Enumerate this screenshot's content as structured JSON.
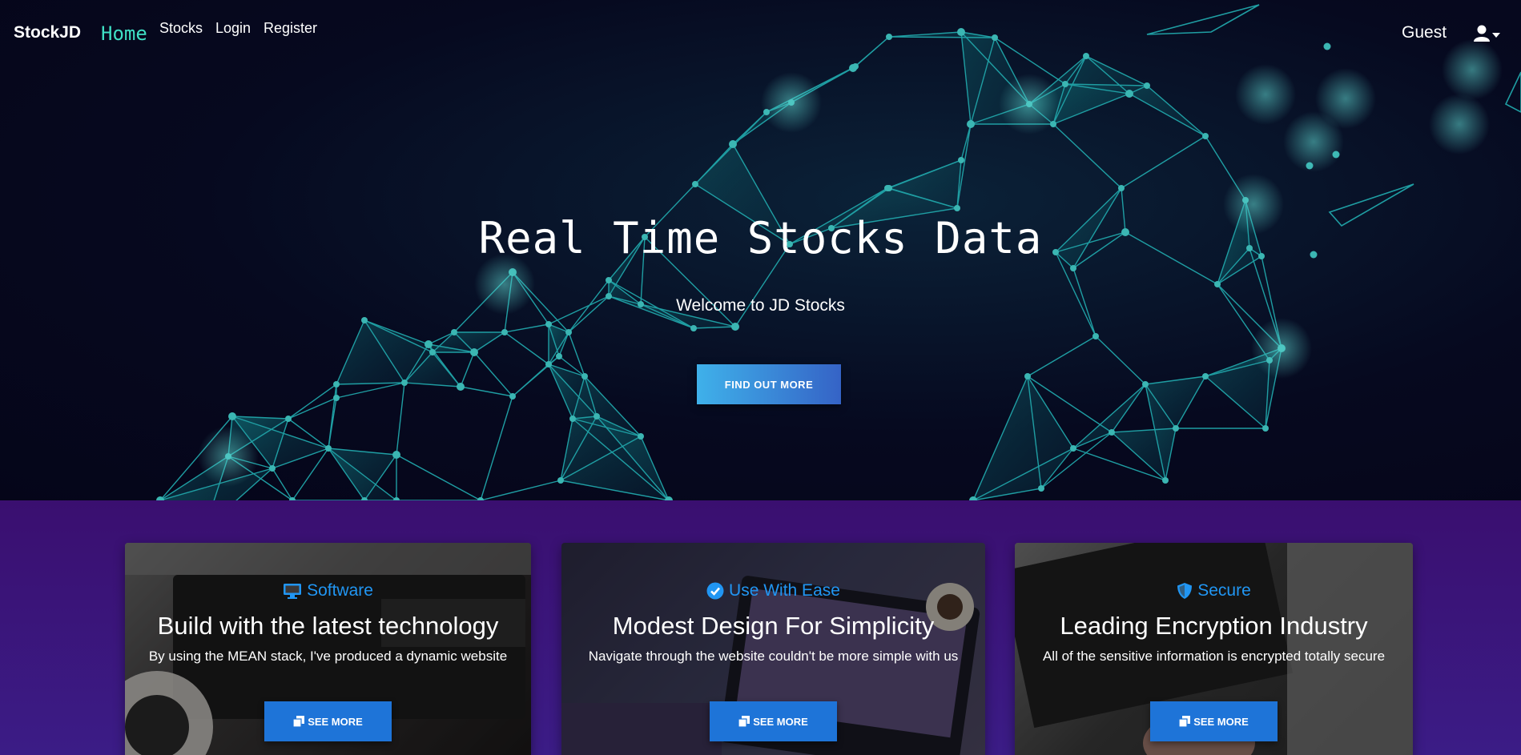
{
  "navbar": {
    "brand": "StockJD",
    "home": "Home",
    "links": [
      "Stocks",
      "Login",
      "Register"
    ],
    "guest": "Guest",
    "user_icon": "user-icon",
    "dropdown_icon": "caret-down-icon"
  },
  "hero": {
    "title": "Real Time Stocks Data",
    "subtitle": "Welcome to JD Stocks",
    "button": "FIND OUT MORE"
  },
  "features": [
    {
      "tag": "Software",
      "icon": "desktop-icon",
      "title": "Build with the latest technology",
      "text": "By using the MEAN stack, I've produced a dynamic website",
      "button": "SEE MORE"
    },
    {
      "tag": "Use With Ease",
      "icon": "check-circle-icon",
      "title": "Modest Design For Simplicity",
      "text": "Navigate through the website couldn't be more simple with us",
      "button": "SEE MORE"
    },
    {
      "tag": "Secure",
      "icon": "shield-icon",
      "title": "Leading Encryption Industry",
      "text": "All of the sensitive information is encrypted totally secure",
      "button": "SEE MORE"
    }
  ],
  "colors": {
    "accent_home": "#3fe0c5",
    "tag_blue": "#2196f3",
    "button_blue": "#1e74d8",
    "network_teal": "#1fa3a6",
    "features_bg": "#3a0f70"
  }
}
